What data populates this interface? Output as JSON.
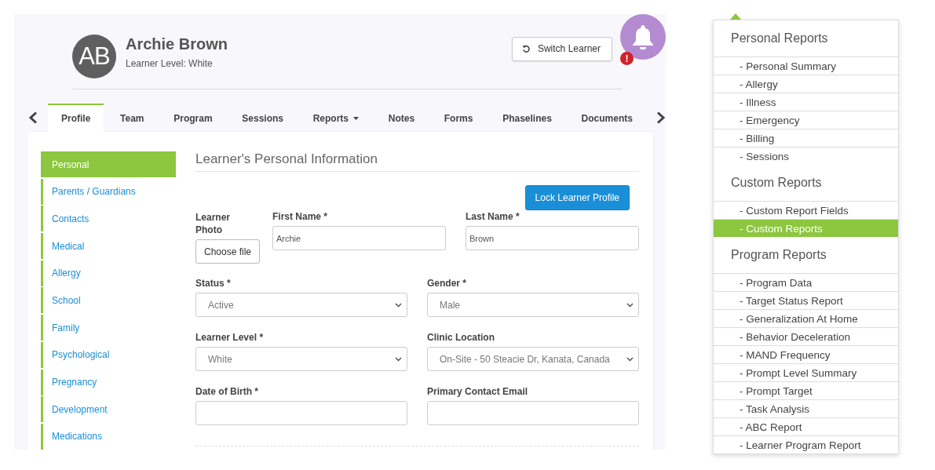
{
  "learner": {
    "initials": "AB",
    "name": "Archie Brown",
    "level": "Learner Level: White"
  },
  "switch_button": "Switch Learner",
  "notification": {
    "badge": "!"
  },
  "tabs": [
    {
      "label": "Profile",
      "selected": true,
      "dropdown": false
    },
    {
      "label": "Team",
      "selected": false,
      "dropdown": false
    },
    {
      "label": "Program",
      "selected": false,
      "dropdown": false
    },
    {
      "label": "Sessions",
      "selected": false,
      "dropdown": false
    },
    {
      "label": "Reports",
      "selected": false,
      "dropdown": true
    },
    {
      "label": "Notes",
      "selected": false,
      "dropdown": false
    },
    {
      "label": "Forms",
      "selected": false,
      "dropdown": false
    },
    {
      "label": "Phaselines",
      "selected": false,
      "dropdown": false
    },
    {
      "label": "Documents",
      "selected": false,
      "dropdown": false
    }
  ],
  "sidebar": [
    {
      "label": "Personal",
      "selected": true
    },
    {
      "label": "Parents / Guardians",
      "selected": false
    },
    {
      "label": "Contacts",
      "selected": false
    },
    {
      "label": "Medical",
      "selected": false
    },
    {
      "label": "Allergy",
      "selected": false
    },
    {
      "label": "School",
      "selected": false
    },
    {
      "label": "Family",
      "selected": false
    },
    {
      "label": "Psychological",
      "selected": false
    },
    {
      "label": "Pregnancy",
      "selected": false
    },
    {
      "label": "Development",
      "selected": false
    },
    {
      "label": "Medications",
      "selected": false
    }
  ],
  "form": {
    "heading": "Learner's Personal Information",
    "lock_button": "Lock Learner Profile",
    "photo_label": "Learner Photo",
    "choose_file": "Choose file",
    "fields": [
      {
        "label": "First Name *",
        "kind": "text",
        "value": "Archie"
      },
      {
        "label": "Last Name *",
        "kind": "text",
        "value": "Brown"
      },
      {
        "label": "Status *",
        "kind": "select",
        "value": "Active"
      },
      {
        "label": "Gender *",
        "kind": "select",
        "value": "Male"
      },
      {
        "label": "Learner Level *",
        "kind": "select",
        "value": "White"
      },
      {
        "label": "Clinic Location",
        "kind": "select",
        "value": "On-Site - 50 Steacie Dr, Kanata, Canada"
      },
      {
        "label": "Date of Birth *",
        "kind": "text"
      },
      {
        "label": "Primary Contact Email",
        "kind": "text"
      }
    ]
  },
  "reports_menu": {
    "sections": [
      {
        "title": "Personal Reports",
        "items": [
          {
            "label": "- Personal Summary",
            "selected": false
          },
          {
            "label": "- Allergy",
            "selected": false
          },
          {
            "label": "- Illness",
            "selected": false
          },
          {
            "label": "- Emergency",
            "selected": false
          },
          {
            "label": "- Billing",
            "selected": false
          },
          {
            "label": "- Sessions",
            "selected": false
          }
        ]
      },
      {
        "title": "Custom Reports",
        "items": [
          {
            "label": "- Custom Report Fields",
            "selected": false
          },
          {
            "label": "- Custom Reports",
            "selected": true
          }
        ]
      },
      {
        "title": "Program Reports",
        "items": [
          {
            "label": "- Program Data",
            "selected": false
          },
          {
            "label": "- Target Status Report",
            "selected": false
          },
          {
            "label": "- Generalization At Home",
            "selected": false
          },
          {
            "label": "- Behavior Deceleration",
            "selected": false
          },
          {
            "label": "- MAND Frequency",
            "selected": false
          },
          {
            "label": "- Prompt Level Summary",
            "selected": false
          },
          {
            "label": "- Prompt Target",
            "selected": false
          },
          {
            "label": "- Task Analysis",
            "selected": false
          },
          {
            "label": "- ABC Report",
            "selected": false
          },
          {
            "label": "- Learner Program Report",
            "selected": false
          }
        ]
      }
    ]
  }
}
